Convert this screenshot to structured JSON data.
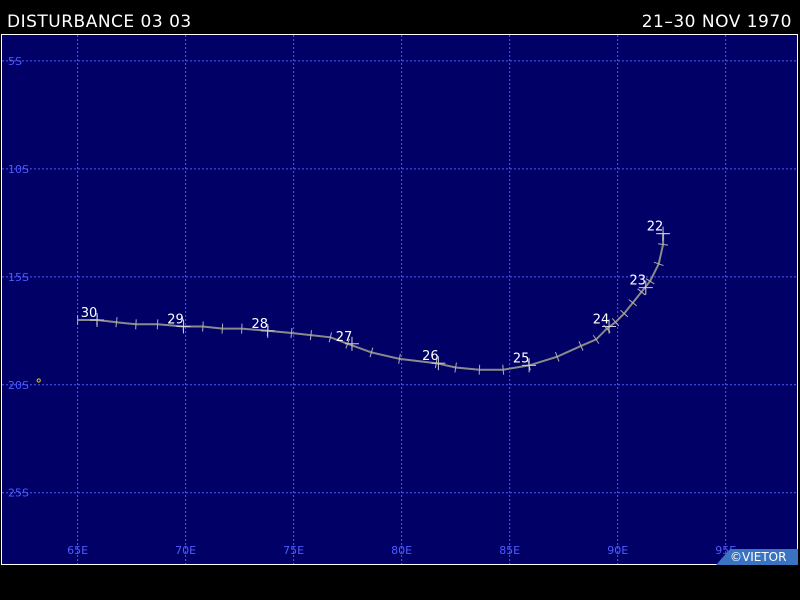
{
  "header": {
    "title": "DISTURBANCE 03 03",
    "date_range": "21–30 NOV 1970"
  },
  "copyright": "©VIETOR",
  "colors": {
    "ocean": "#000066",
    "grid": "#4d5cff",
    "track": "#8a8a8a",
    "text": "#ffffff"
  },
  "map": {
    "lon_range": [
      61.5,
      98.3
    ],
    "lat_range": [
      -3.8,
      -28.3
    ],
    "lon_ticks": [
      {
        "value": 65,
        "label": "65E"
      },
      {
        "value": 70,
        "label": "70E"
      },
      {
        "value": 75,
        "label": "75E"
      },
      {
        "value": 80,
        "label": "80E"
      },
      {
        "value": 85,
        "label": "85E"
      },
      {
        "value": 90,
        "label": "90E"
      },
      {
        "value": 95,
        "label": "95E"
      }
    ],
    "lat_ticks": [
      {
        "value": -5,
        "label": "5S"
      },
      {
        "value": -10,
        "label": "10S"
      },
      {
        "value": -15,
        "label": "15S"
      },
      {
        "value": -20,
        "label": "20S"
      },
      {
        "value": -25,
        "label": "25S"
      }
    ],
    "track": [
      {
        "lon": 92.1,
        "lat": -13.0
      },
      {
        "lon": 92.1,
        "lat": -13.5
      },
      {
        "lon": 91.9,
        "lat": -14.4
      },
      {
        "lon": 91.5,
        "lat": -15.2
      },
      {
        "lon": 91.1,
        "lat": -15.7
      },
      {
        "lon": 90.7,
        "lat": -16.2
      },
      {
        "lon": 90.3,
        "lat": -16.7
      },
      {
        "lon": 89.9,
        "lat": -17.1
      },
      {
        "lon": 89.5,
        "lat": -17.4
      },
      {
        "lon": 89.0,
        "lat": -17.9
      },
      {
        "lon": 88.3,
        "lat": -18.2
      },
      {
        "lon": 87.2,
        "lat": -18.7
      },
      {
        "lon": 85.9,
        "lat": -19.1
      },
      {
        "lon": 84.7,
        "lat": -19.3
      },
      {
        "lon": 83.6,
        "lat": -19.3
      },
      {
        "lon": 82.5,
        "lat": -19.2
      },
      {
        "lon": 81.6,
        "lat": -19.0
      },
      {
        "lon": 79.9,
        "lat": -18.8
      },
      {
        "lon": 78.6,
        "lat": -18.5
      },
      {
        "lon": 77.5,
        "lat": -18.1
      },
      {
        "lon": 76.7,
        "lat": -17.8
      },
      {
        "lon": 75.8,
        "lat": -17.7
      },
      {
        "lon": 74.9,
        "lat": -17.6
      },
      {
        "lon": 73.8,
        "lat": -17.5
      },
      {
        "lon": 72.6,
        "lat": -17.4
      },
      {
        "lon": 71.7,
        "lat": -17.4
      },
      {
        "lon": 70.8,
        "lat": -17.3
      },
      {
        "lon": 69.9,
        "lat": -17.3
      },
      {
        "lon": 68.7,
        "lat": -17.2
      },
      {
        "lon": 67.7,
        "lat": -17.2
      },
      {
        "lon": 66.8,
        "lat": -17.1
      },
      {
        "lon": 65.9,
        "lat": -17.0
      },
      {
        "lon": 65.0,
        "lat": -17.0
      }
    ],
    "day_labels": [
      {
        "text": "22",
        "lon": 92.1,
        "lat": -13.0
      },
      {
        "text": "23",
        "lon": 91.3,
        "lat": -15.5
      },
      {
        "text": "24",
        "lon": 89.6,
        "lat": -17.3
      },
      {
        "text": "25",
        "lon": 85.9,
        "lat": -19.1
      },
      {
        "text": "26",
        "lon": 81.7,
        "lat": -19.0
      },
      {
        "text": "27",
        "lon": 77.7,
        "lat": -18.1
      },
      {
        "text": "28",
        "lon": 73.8,
        "lat": -17.5
      },
      {
        "text": "29",
        "lon": 69.9,
        "lat": -17.3
      },
      {
        "text": "30",
        "lon": 65.9,
        "lat": -17.0
      }
    ],
    "marker": {
      "lon": 63.2,
      "lat": -19.8
    }
  }
}
